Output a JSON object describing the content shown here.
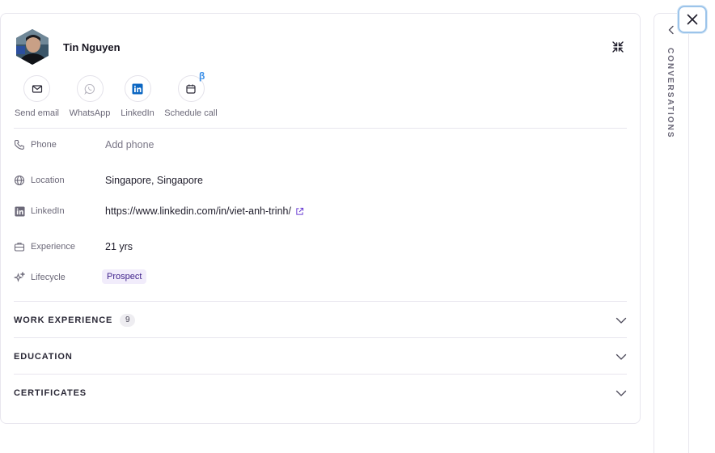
{
  "profile": {
    "name": "Tin Nguyen"
  },
  "actions": {
    "email": "Send email",
    "whatsapp": "WhatsApp",
    "linkedin": "LinkedIn",
    "schedule": "Schedule call",
    "beta": "β"
  },
  "fields": {
    "phone": {
      "label": "Phone",
      "placeholder": "Add phone"
    },
    "location": {
      "label": "Location",
      "value": "Singapore, Singapore"
    },
    "linkedin": {
      "label": "LinkedIn",
      "value": "https://www.linkedin.com/in/viet-anh-trinh/"
    },
    "experience": {
      "label": "Experience",
      "value": "21 yrs"
    },
    "lifecycle": {
      "label": "Lifecycle",
      "value": "Prospect"
    }
  },
  "sections": {
    "work": {
      "title": "WORK EXPERIENCE",
      "count": "9"
    },
    "education": {
      "title": "EDUCATION"
    },
    "certificates": {
      "title": "CERTIFICATES"
    }
  },
  "rail": {
    "title": "CONVERSATIONS"
  },
  "colors": {
    "linkedin_blue": "#0a66c2",
    "beta_blue": "#3b8fe8",
    "lifecycle_bg": "#f1ecfb",
    "lifecycle_text": "#3d1f8a",
    "close_focus_ring": "#9cc4ea"
  }
}
